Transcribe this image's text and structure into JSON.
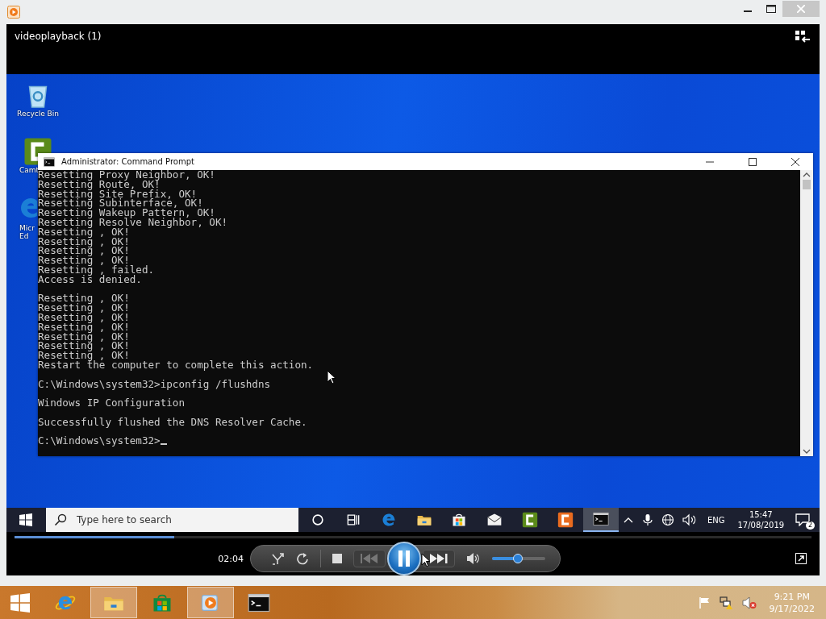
{
  "player": {
    "title": "videoplayback (1)",
    "time": "02:04",
    "playing": true,
    "seek": {
      "level": 0.2
    },
    "volume": {
      "level": 0.48
    }
  },
  "desktop_icons": [
    {
      "kind": "recycle",
      "lines": [
        "Recycle Bin"
      ]
    },
    {
      "kind": "camtasia",
      "lines": [
        "Camt"
      ]
    },
    {
      "kind": "edge",
      "lines": [
        "Micr",
        "Ed"
      ]
    }
  ],
  "console": {
    "title": "Administrator: Command Prompt",
    "cursor": true,
    "blocks": [
      {
        "blank_before": false,
        "blank_after": false,
        "lines": [
          "Resetting Proxy Neighbor, OK!",
          "Resetting Route, OK!",
          "Resetting Site Prefix, OK!",
          "Resetting Subinterface, OK!",
          "Resetting Wakeup Pattern, OK!",
          "Resetting Resolve Neighbor, OK!",
          "Resetting , OK!",
          "Resetting , OK!",
          "Resetting , OK!",
          "Resetting , OK!",
          "Resetting , failed.",
          "Access is denied."
        ]
      },
      {
        "blank_before": true,
        "blank_after": true,
        "lines": [
          "Resetting , OK!",
          "Resetting , OK!",
          "Resetting , OK!",
          "Resetting , OK!",
          "Resetting , OK!",
          "Resetting , OK!",
          "Resetting , OK!",
          "Restart the computer to complete this action."
        ]
      },
      {
        "blank_before": true,
        "blank_after": false,
        "lines": [
          "C:\\Windows\\system32>ipconfig /flushdns"
        ]
      },
      {
        "blank_before": true,
        "blank_after": false,
        "lines": [
          "Windows IP Configuration"
        ]
      },
      {
        "blank_before": true,
        "blank_after": false,
        "lines": [
          "Successfully flushed the DNS Resolver Cache."
        ]
      },
      {
        "blank_before": true,
        "blank_after": false,
        "lines": [
          "C:\\Windows\\system32>"
        ]
      }
    ]
  },
  "video_taskbar": {
    "search": {
      "placeholder": "Type here to search"
    },
    "apps": [
      {
        "kind": "cortana",
        "selected": false
      },
      {
        "kind": "task-view",
        "selected": false
      },
      {
        "kind": "edge",
        "selected": false
      },
      {
        "kind": "folder",
        "selected": false
      },
      {
        "kind": "store",
        "selected": false
      },
      {
        "kind": "mail",
        "selected": false
      },
      {
        "kind": "camtasia",
        "selected": false
      },
      {
        "kind": "camtasia-alt",
        "selected": false
      },
      {
        "kind": "console",
        "selected": true
      }
    ],
    "language": "ENG",
    "time": "15:47",
    "date": "17/08/2019",
    "notification_count": "2"
  },
  "host_taskbar": {
    "apps": [
      {
        "kind": "ie",
        "highlighted": false
      },
      {
        "kind": "folder",
        "highlighted": true
      },
      {
        "kind": "store",
        "highlighted": false
      },
      {
        "kind": "media-player",
        "highlighted": true
      },
      {
        "kind": "console",
        "highlighted": false
      }
    ],
    "time": "9:21 PM",
    "date": "9/17/2022"
  }
}
